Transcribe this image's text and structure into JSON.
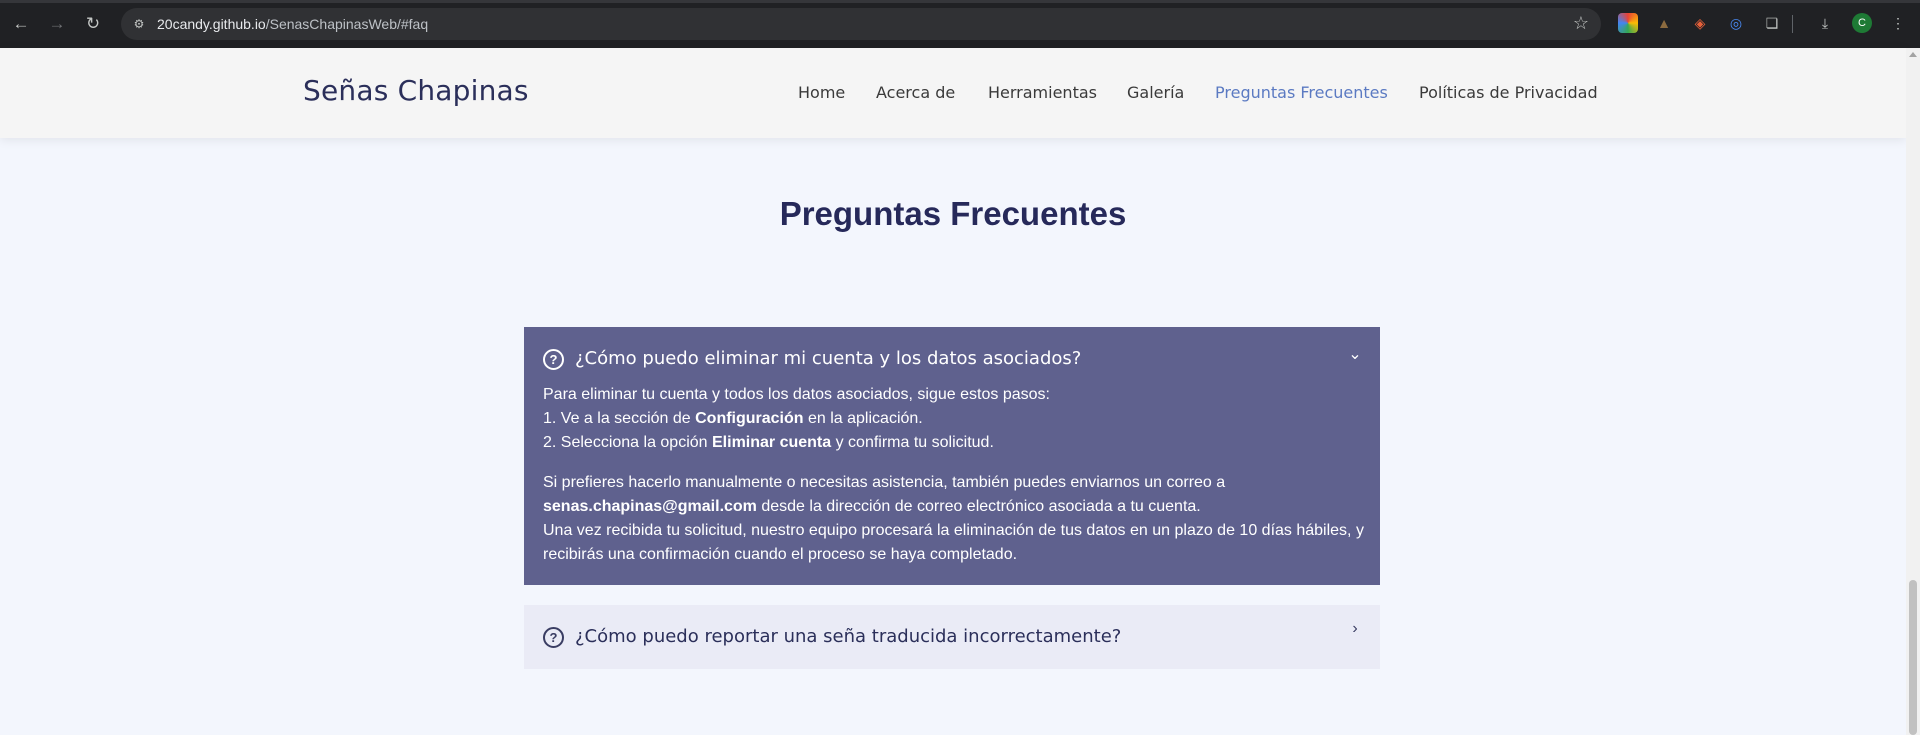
{
  "browser": {
    "url_host": "20candy.github.io",
    "url_path": "/SenasChapinasWeb/#faq",
    "profile_initial": "C"
  },
  "header": {
    "brand": "Señas Chapinas",
    "nav": [
      {
        "label": "Home",
        "active": false
      },
      {
        "label": "Acerca de",
        "active": false
      },
      {
        "label": "Herramientas",
        "active": false
      },
      {
        "label": "Galería",
        "active": false
      },
      {
        "label": "Preguntas Frecuentes",
        "active": true
      },
      {
        "label": "Políticas de Privacidad",
        "active": false
      }
    ],
    "active_color": "#5b7ac2"
  },
  "section": {
    "title": "Preguntas Frecuentes"
  },
  "faq": [
    {
      "question": "¿Cómo puedo eliminar mi cuenta y los datos asociados?",
      "expanded": true,
      "icon": "question-circle-icon",
      "answer": {
        "intro": "Para eliminar tu cuenta y todos los datos asociados, sigue estos pasos:",
        "step1_pre": "1. Ve a la sección de ",
        "step1_bold": "Configuración",
        "step1_post": " en la aplicación.",
        "step2_pre": "2. Selecciona la opción ",
        "step2_bold": "Eliminar cuenta",
        "step2_post": " y confirma tu solicitud.",
        "manual_line": "Si prefieres hacerlo manualmente o necesitas asistencia, también puedes enviarnos un correo a",
        "email": "senas.chapinas@gmail.com",
        "email_post": " desde la dirección de correo electrónico asociada a tu cuenta.",
        "processing_1": "Una vez recibida tu solicitud, nuestro equipo procesará la eliminación de tus datos en un plazo de 10 días hábiles, y",
        "processing_2": "recibirás una confirmación cuando el proceso se haya completado."
      }
    },
    {
      "question": "¿Cómo puedo reportar una seña traducida incorrectamente?",
      "expanded": false,
      "icon": "question-circle-icon"
    }
  ],
  "colors": {
    "page_bg": "#f3f6fd",
    "faq_open_bg": "#5f618e",
    "faq_closed_bg": "#eaebf6",
    "title_color": "#26295a"
  }
}
